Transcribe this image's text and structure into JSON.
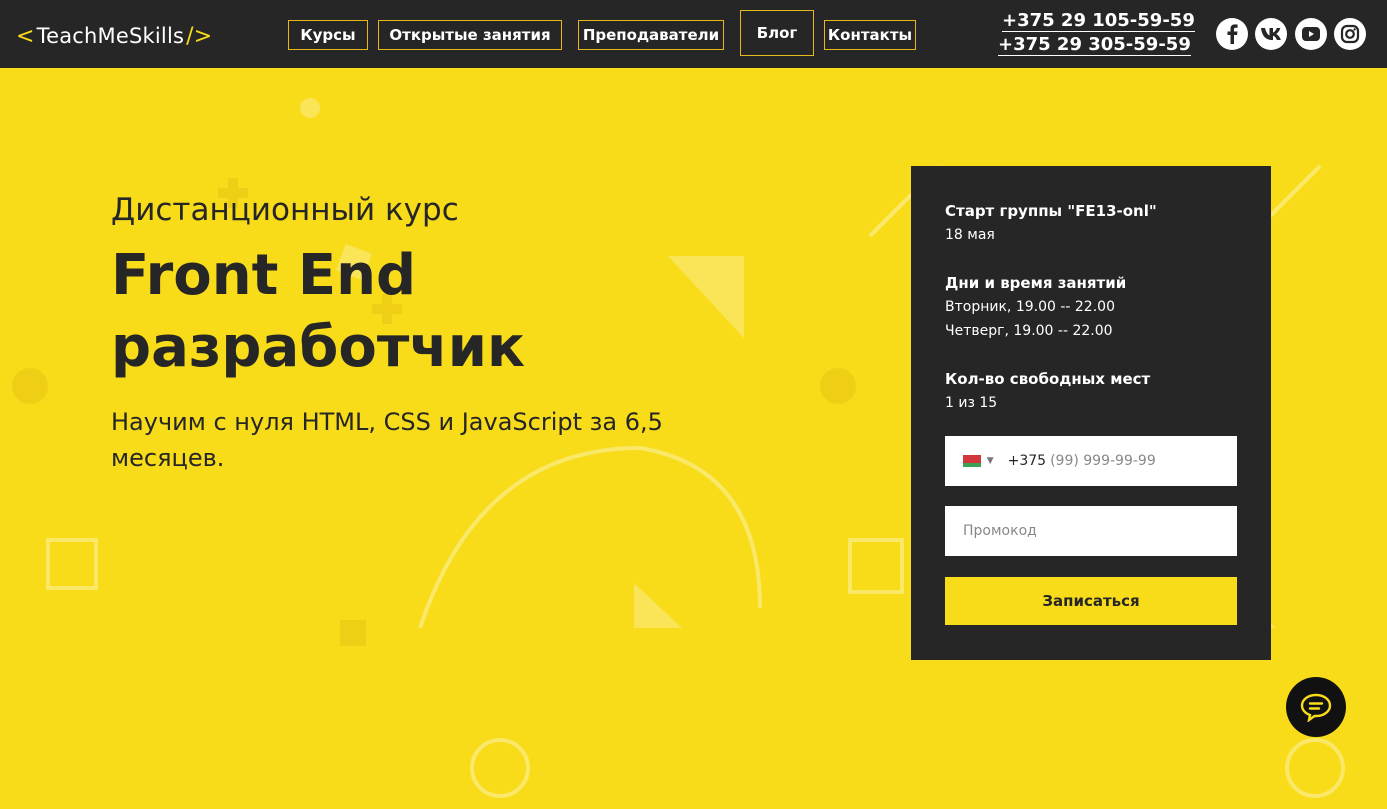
{
  "header": {
    "logo": {
      "text": "TeachMeSkills",
      "left_bracket": "<",
      "right_bracket": "/>"
    },
    "nav": [
      {
        "label": "Курсы"
      },
      {
        "label": "Открытые занятия"
      },
      {
        "label": "Преподаватели"
      },
      {
        "label": "Блог"
      },
      {
        "label": "Контакты"
      }
    ],
    "phones": [
      "+375 29 105-59-59",
      "+375 29 305-59-59"
    ],
    "socials": [
      "facebook-icon",
      "vk-icon",
      "youtube-icon",
      "instagram-icon"
    ]
  },
  "hero": {
    "subtitle": "Дистанционный курс",
    "title_line1": "Front End",
    "title_line2": "разработчик",
    "description": "Научим с нуля HTML, CSS и JavaScript за 6,5 месяцев."
  },
  "form": {
    "start_label": "Старт группы \"FE13-onl\"",
    "start_value": "18 мая",
    "schedule_label": "Дни и время занятий",
    "schedule_values": [
      "Вторник, 19.00 -- 22.00",
      "Четверг, 19.00 -- 22.00"
    ],
    "seats_label": "Кол-во свободных мест",
    "seats_value": "1 из 15",
    "phone_code": "+375",
    "phone_placeholder": "(99) 999-99-99",
    "promo_placeholder": "Промокод",
    "submit_label": "Записаться"
  },
  "colors": {
    "accent": "#f8dc1a",
    "dark": "#262626"
  }
}
